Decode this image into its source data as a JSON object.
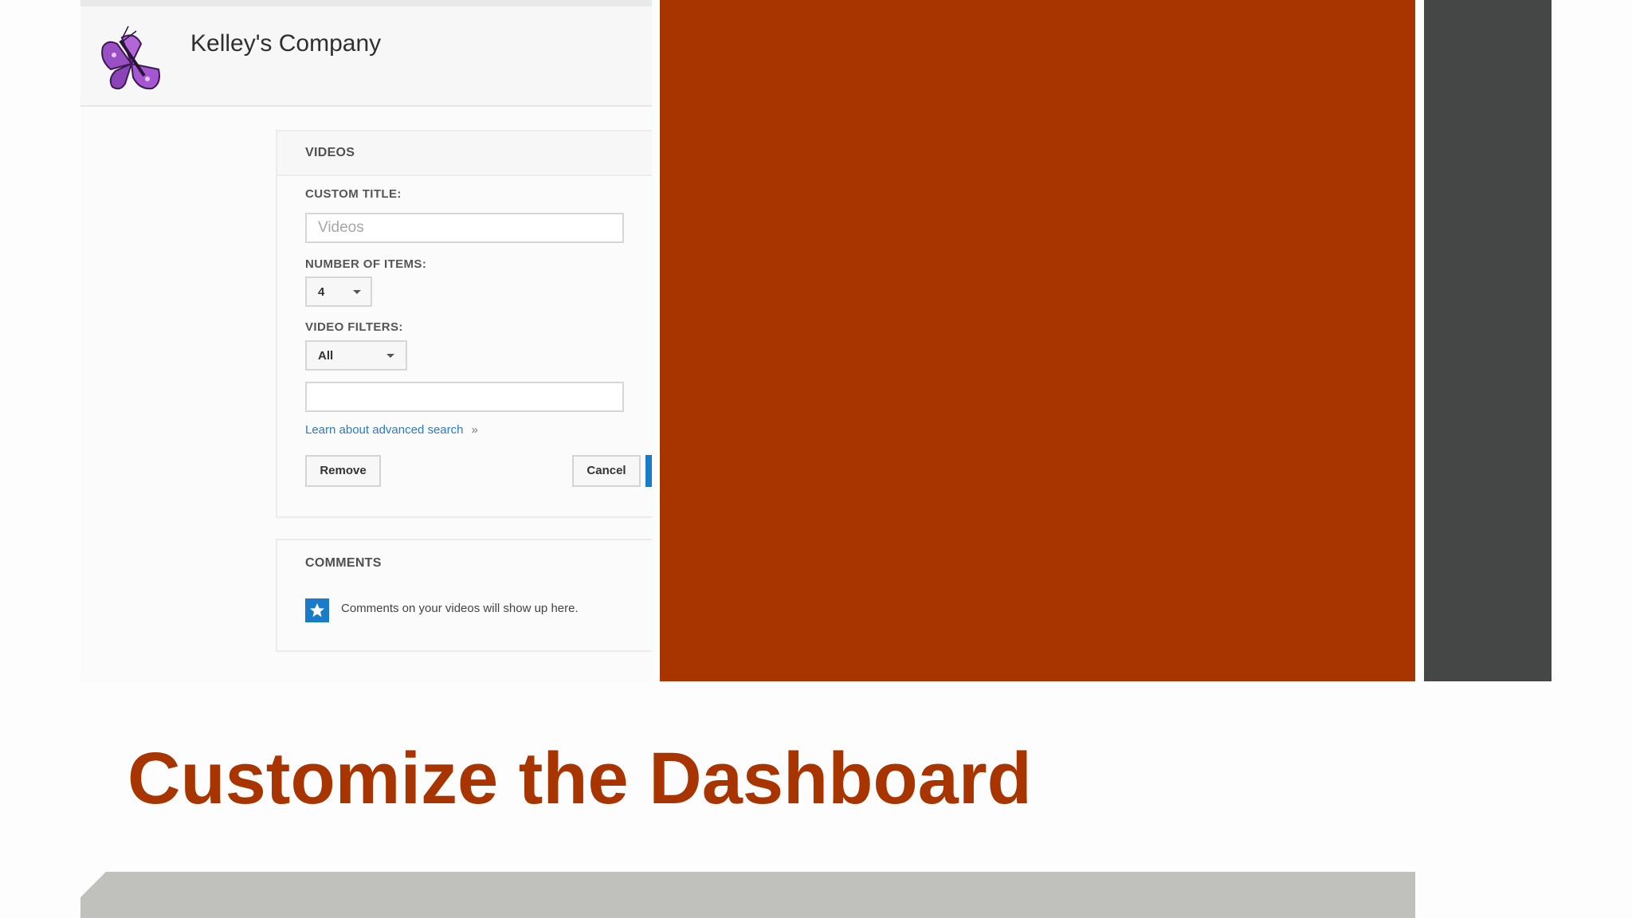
{
  "header": {
    "company_name": "Kelley's Company",
    "logo_icon": "butterfly-icon"
  },
  "videos_card": {
    "title": "VIDEOS",
    "custom_title_label": "CUSTOM TITLE:",
    "custom_title_placeholder": "Videos",
    "number_of_items_label": "NUMBER OF ITEMS:",
    "number_of_items_value": "4",
    "video_filters_label": "VIDEO FILTERS:",
    "video_filters_value": "All",
    "search_value": "",
    "advanced_search_link": "Learn about advanced search",
    "link_chevron": "»",
    "remove_button": "Remove",
    "cancel_button": "Cancel"
  },
  "comments_card": {
    "title": "COMMENTS",
    "message": "Comments on your videos will show up here.",
    "icon": "star-icon"
  },
  "slide": {
    "title": "Customize the Dashboard"
  },
  "colors": {
    "accent": "#a83400",
    "dark": "#444745",
    "link": "#2a7bc9",
    "button_blue": "#1a7cc9",
    "footer": "#c0c0bc"
  }
}
